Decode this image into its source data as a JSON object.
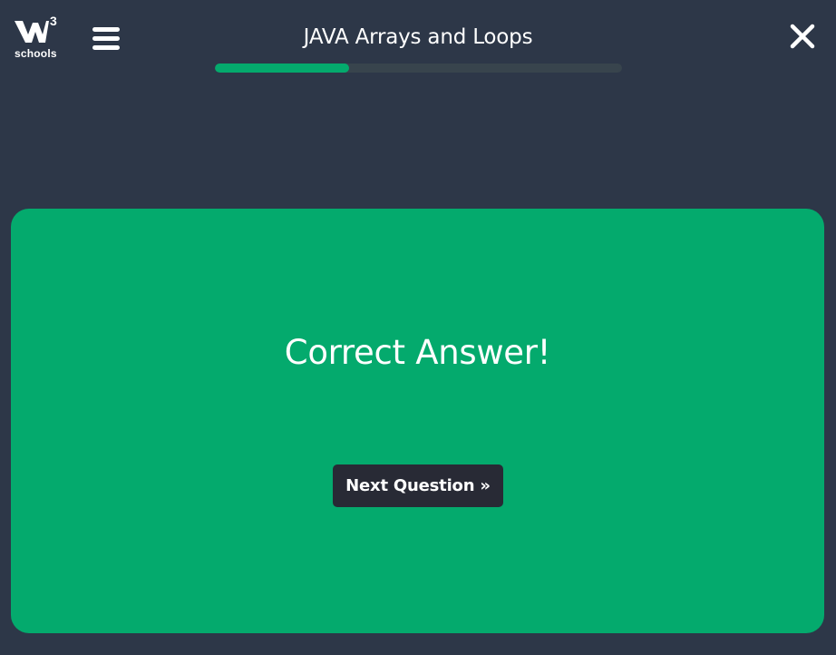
{
  "header": {
    "logo_superscript": "3",
    "logo_word": "schools",
    "title": "JAVA Arrays and Loops",
    "progress_fraction": 0.33,
    "menu_icon": "hamburger-menu-icon",
    "close_icon": "close-icon"
  },
  "result": {
    "message": "Correct Answer!",
    "next_button_label": "Next Question »"
  },
  "colors": {
    "background": "#2d3748",
    "accent_green": "#04aa6d",
    "progress_track": "#38444d",
    "button_dark": "#282a35",
    "text": "#ffffff"
  }
}
